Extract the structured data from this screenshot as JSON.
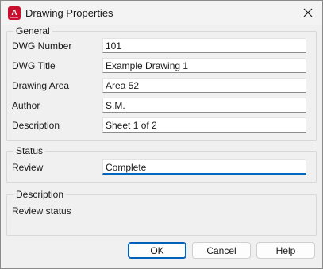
{
  "window": {
    "title": "Drawing Properties",
    "app_icon_letter": "A",
    "accent_color": "#c8102e"
  },
  "general": {
    "legend": "General",
    "fields": [
      {
        "label": "DWG Number",
        "value": "101"
      },
      {
        "label": "DWG Title",
        "value": "Example Drawing 1"
      },
      {
        "label": "Drawing Area",
        "value": "Area 52"
      },
      {
        "label": "Author",
        "value": "S.M."
      },
      {
        "label": "Description",
        "value": "Sheet 1 of 2"
      }
    ]
  },
  "status": {
    "legend": "Status",
    "review_label": "Review",
    "review_value": "Complete"
  },
  "description": {
    "legend": "Description",
    "text": "Review status"
  },
  "buttons": {
    "ok": "OK",
    "cancel": "Cancel",
    "help": "Help"
  }
}
